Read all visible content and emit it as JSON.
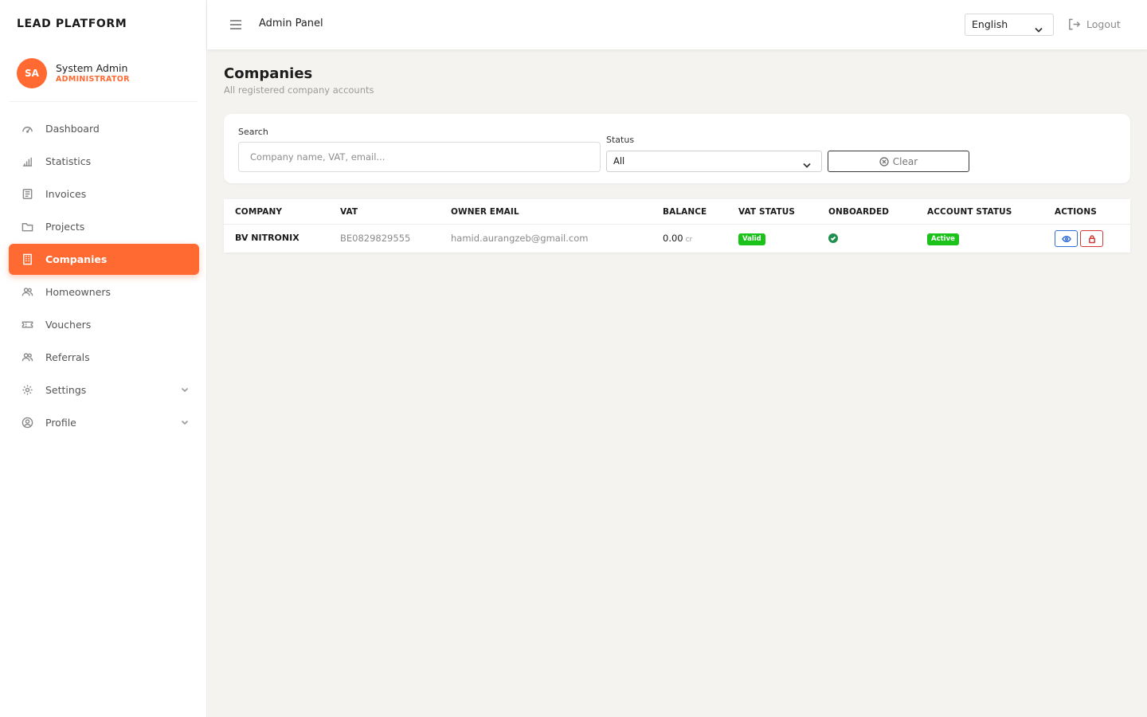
{
  "sidebar": {
    "brand": "LEAD PLATFORM",
    "user": {
      "initials": "SA",
      "name": "System Admin",
      "role": "ADMINISTRATOR"
    },
    "items": [
      {
        "label": "Dashboard",
        "icon": "gauge-icon"
      },
      {
        "label": "Statistics",
        "icon": "bar-chart-icon"
      },
      {
        "label": "Invoices",
        "icon": "invoice-icon"
      },
      {
        "label": "Projects",
        "icon": "folder-icon"
      },
      {
        "label": "Companies",
        "icon": "building-icon",
        "active": true
      },
      {
        "label": "Homeowners",
        "icon": "users-icon"
      },
      {
        "label": "Vouchers",
        "icon": "ticket-icon"
      },
      {
        "label": "Referrals",
        "icon": "users-icon"
      },
      {
        "label": "Settings",
        "icon": "gear-icon",
        "expandable": true
      },
      {
        "label": "Profile",
        "icon": "user-circle-icon",
        "expandable": true
      }
    ]
  },
  "header": {
    "title": "Admin Panel",
    "language": "English",
    "logout_label": "Logout"
  },
  "page": {
    "title": "Companies",
    "subtitle": "All registered company accounts"
  },
  "filters": {
    "search_label": "Search",
    "search_placeholder": "Company name, VAT, email...",
    "search_value": "",
    "status_label": "Status",
    "status_value": "All",
    "clear_label": "Clear"
  },
  "table": {
    "headers": [
      "COMPANY",
      "VAT",
      "OWNER EMAIL",
      "BALANCE",
      "VAT STATUS",
      "ONBOARDED",
      "ACCOUNT STATUS",
      "ACTIONS"
    ],
    "rows": [
      {
        "company": "BV NITRONIX",
        "vat": "BE0829829555",
        "owner_email": "hamid.aurangzeb@gmail.com",
        "balance": "0.00",
        "balance_unit": "cr",
        "vat_status": "Valid",
        "onboarded": true,
        "account_status": "Active"
      }
    ]
  },
  "colors": {
    "accent": "#ff6a33",
    "status_green": "#1ac21a",
    "onboarded_green": "#1f8f4e",
    "view_blue": "#2f6fd6",
    "lock_red": "#d33a3a"
  }
}
